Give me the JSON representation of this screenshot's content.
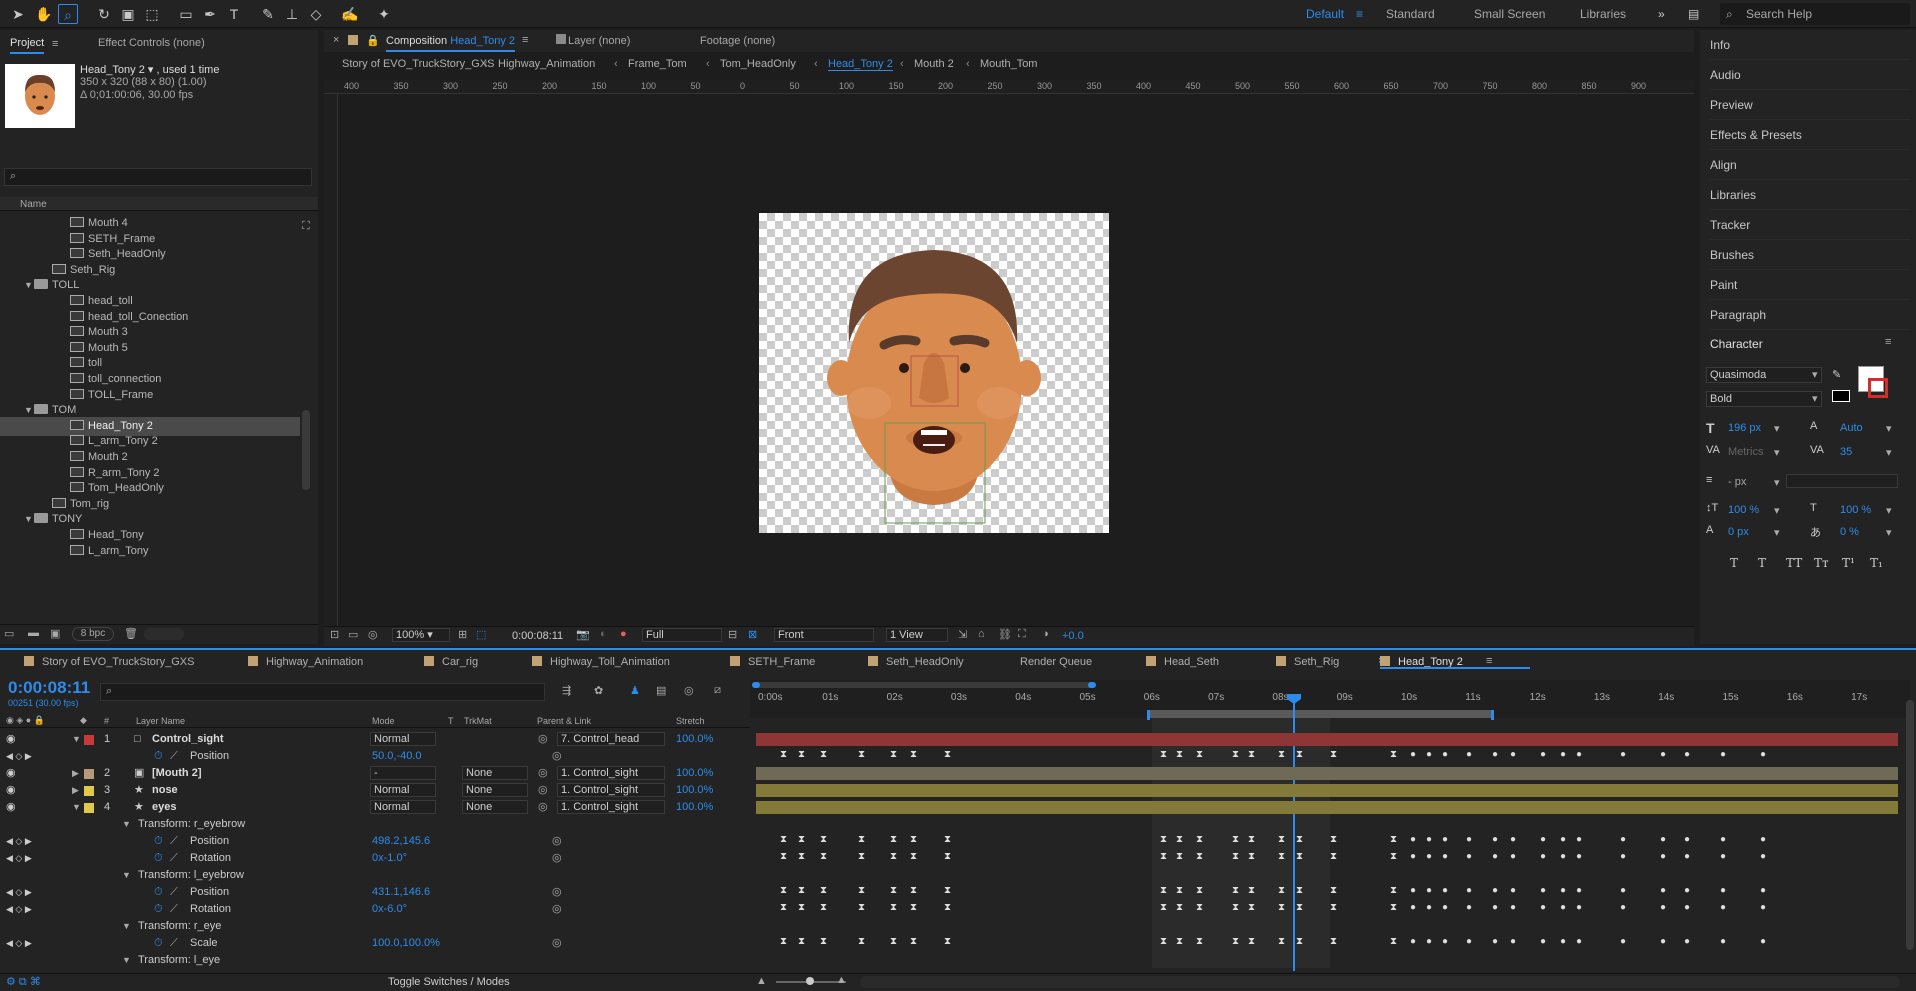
{
  "toolbar": {
    "workspaces": [
      "Default",
      "Standard",
      "Small Screen",
      "Libraries"
    ],
    "search_placeholder": "Search Help"
  },
  "project": {
    "tab_project": "Project",
    "tab_effects": "Effect Controls (none)",
    "preview_name": "Head_Tony 2 ▾ , used 1 time",
    "preview_dims": "350 x 320  (88 x 80) (1.00)",
    "preview_dur": "Δ 0;01:00:06, 30.00 fps",
    "col_name": "Name",
    "bpc": "8 bpc",
    "items": [
      {
        "label": "Mouth 4",
        "type": "comp",
        "indent": 2
      },
      {
        "label": "SETH_Frame",
        "type": "comp",
        "indent": 2
      },
      {
        "label": "Seth_HeadOnly",
        "type": "comp",
        "indent": 2
      },
      {
        "label": "Seth_Rig",
        "type": "comp",
        "indent": 1
      },
      {
        "label": "TOLL",
        "type": "folder",
        "indent": 1
      },
      {
        "label": "head_toll",
        "type": "comp",
        "indent": 2
      },
      {
        "label": "head_toll_Conection",
        "type": "comp",
        "indent": 2
      },
      {
        "label": "Mouth 3",
        "type": "comp",
        "indent": 2
      },
      {
        "label": "Mouth 5",
        "type": "comp",
        "indent": 2
      },
      {
        "label": "toll",
        "type": "comp",
        "indent": 2
      },
      {
        "label": "toll_connection",
        "type": "comp",
        "indent": 2
      },
      {
        "label": "TOLL_Frame",
        "type": "comp",
        "indent": 2
      },
      {
        "label": "TOM",
        "type": "folder",
        "indent": 1
      },
      {
        "label": "Head_Tony 2",
        "type": "comp",
        "indent": 2,
        "selected": true
      },
      {
        "label": "L_arm_Tony 2",
        "type": "comp",
        "indent": 2
      },
      {
        "label": "Mouth 2",
        "type": "comp",
        "indent": 2
      },
      {
        "label": "R_arm_Tony 2",
        "type": "comp",
        "indent": 2
      },
      {
        "label": "Tom_HeadOnly",
        "type": "comp",
        "indent": 2
      },
      {
        "label": "Tom_rig",
        "type": "comp",
        "indent": 1
      },
      {
        "label": "TONY",
        "type": "folder",
        "indent": 1
      },
      {
        "label": "Head_Tony",
        "type": "comp",
        "indent": 2
      },
      {
        "label": "L_arm_Tony",
        "type": "comp",
        "indent": 2
      }
    ]
  },
  "viewer": {
    "tab_comp_prefix": "Composition",
    "tab_comp_name": "Head_Tony 2",
    "tab_layer": "Layer (none)",
    "tab_footage": "Footage (none)",
    "breadcrumbs": [
      "Story of EVO_TruckStory_GXS",
      "Highway_Animation",
      "Frame_Tom",
      "Tom_HeadOnly",
      "Head_Tony 2",
      "Mouth 2",
      "Mouth_Tom"
    ],
    "ruler": [
      "400",
      "350",
      "300",
      "250",
      "200",
      "150",
      "100",
      "50",
      "0",
      "50",
      "100",
      "150",
      "200",
      "250",
      "300",
      "350",
      "400",
      "450",
      "500",
      "550",
      "600",
      "650",
      "700",
      "750",
      "800",
      "850",
      "900"
    ],
    "zoom": "100%",
    "timecode": "0:00:08:11",
    "resolution": "Full",
    "view": "Front",
    "views": "1 View",
    "exposure": "+0.0"
  },
  "right_panel": {
    "items": [
      "Info",
      "Audio",
      "Preview",
      "Effects & Presets",
      "Align",
      "Libraries",
      "Tracker",
      "Brushes",
      "Paint",
      "Paragraph"
    ],
    "character_title": "Character",
    "font": "Quasimoda",
    "style": "Bold",
    "font_size": "196 px",
    "leading": "Auto",
    "kerning": "Metrics",
    "tracking": "35",
    "stroke": "- px",
    "vscale": "100 %",
    "hscale": "100 %",
    "baseline": "0 px",
    "tsume": "0 %",
    "format_buttons": [
      "T",
      "T",
      "TT",
      "Tт",
      "T¹",
      "T₁"
    ]
  },
  "timeline": {
    "tabs": [
      "Story of EVO_TruckStory_GXS",
      "Highway_Animation",
      "Car_rig",
      "Highway_Toll_Animation",
      "SETH_Frame",
      "Seth_HeadOnly",
      "Render Queue",
      "Head_Seth",
      "Seth_Rig",
      "Head_Tony 2"
    ],
    "timecode": "0:00:08:11",
    "frame_info": "00251 (30.00 fps)",
    "col_layer_name": "Layer Name",
    "col_mode": "Mode",
    "col_t": "T",
    "col_trkmat": "TrkMat",
    "col_parent": "Parent & Link",
    "col_stretch": "Stretch",
    "col_num": "#",
    "time_labels": [
      "0:00s",
      "01s",
      "02s",
      "03s",
      "04s",
      "05s",
      "06s",
      "07s",
      "08s",
      "09s",
      "10s",
      "11s",
      "12s",
      "13s",
      "14s",
      "15s",
      "16s",
      "17s"
    ],
    "toggle_label": "Toggle Switches / Modes",
    "rows": [
      {
        "kind": "layer",
        "num": "1",
        "name": "Control_sight",
        "mode": "Normal",
        "trkmat": "",
        "parent": "7. Control_head",
        "stretch": "100.0%",
        "color": "#c83a3a",
        "bar": "#8e3535"
      },
      {
        "kind": "prop",
        "name": "Position",
        "value": "50.0,-40.0"
      },
      {
        "kind": "layer",
        "num": "2",
        "name": "[Mouth 2]",
        "mode": "-",
        "trkmat": "None",
        "parent": "1. Control_sight",
        "stretch": "100.0%",
        "color": "#b89a78",
        "bar": "#6f6a55"
      },
      {
        "kind": "layer",
        "num": "3",
        "name": "nose",
        "mode": "Normal",
        "trkmat": "None",
        "parent": "1. Control_sight",
        "stretch": "100.0%",
        "color": "#e0c84a",
        "bar": "#837a3a"
      },
      {
        "kind": "layer",
        "num": "4",
        "name": "eyes",
        "mode": "Normal",
        "trkmat": "None",
        "parent": "1. Control_sight",
        "stretch": "100.0%",
        "color": "#e0c84a",
        "bar": "#837a3a"
      },
      {
        "kind": "group",
        "name": "Transform: r_eyebrow"
      },
      {
        "kind": "prop",
        "name": "Position",
        "value": "498.2,145.6"
      },
      {
        "kind": "prop",
        "name": "Rotation",
        "value": "0x-1.0°"
      },
      {
        "kind": "group",
        "name": "Transform: l_eyebrow"
      },
      {
        "kind": "prop",
        "name": "Position",
        "value": "431.1,146.6"
      },
      {
        "kind": "prop",
        "name": "Rotation",
        "value": "0x-6.0°"
      },
      {
        "kind": "group",
        "name": "Transform: r_eye"
      },
      {
        "kind": "prop",
        "name": "Scale",
        "value": "100.0,100.0%"
      },
      {
        "kind": "group",
        "name": "Transform: l_eye"
      }
    ]
  },
  "colors": {
    "accent": "#2d8ceb",
    "panel": "#232323",
    "bg": "#1d1d1d"
  }
}
